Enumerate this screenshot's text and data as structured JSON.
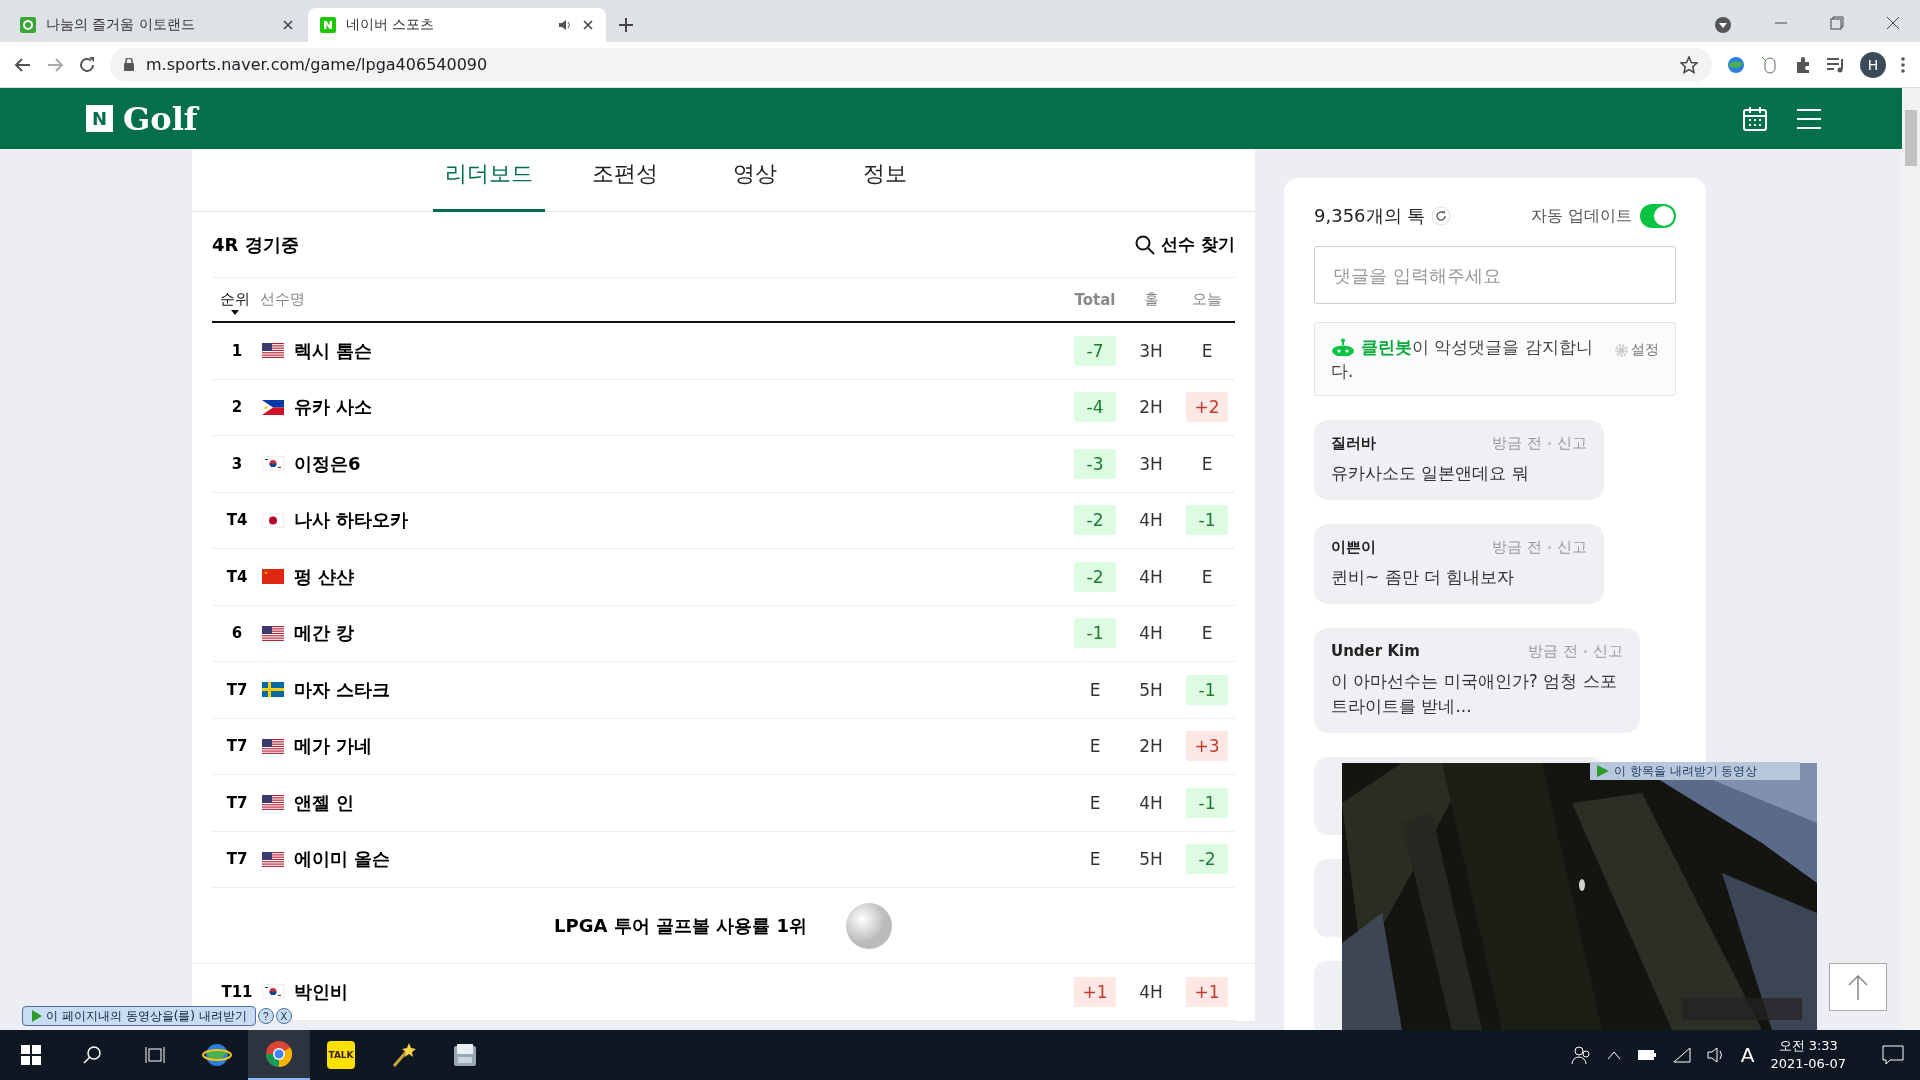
{
  "browser": {
    "tabs": [
      {
        "title": "나눔의 즐거움 이토랜드",
        "kind": "eto",
        "selected": false,
        "audio": false
      },
      {
        "title": "네이버 스포츠",
        "kind": "naver",
        "selected": true,
        "audio": true
      }
    ],
    "url": "m.sports.naver.com/game/lpga406540090",
    "profile": "H"
  },
  "header": {
    "logo": "N",
    "title": "Golf"
  },
  "tabs": [
    {
      "label": "리더보드",
      "selected": true
    },
    {
      "label": "조편성",
      "selected": false
    },
    {
      "label": "영상",
      "selected": false
    },
    {
      "label": "정보",
      "selected": false
    }
  ],
  "leaderboard": {
    "status": "4R 경기중",
    "find": "선수 찾기",
    "columns": [
      {
        "label": "순위",
        "sorted": true
      },
      {
        "label": "선수명",
        "sorted": false
      },
      {
        "label": "Total",
        "sorted": false
      },
      {
        "label": "홀",
        "sorted": false
      },
      {
        "label": "오늘",
        "sorted": false
      }
    ],
    "rows": [
      {
        "rank": "1",
        "flag": {
          "kind": "us"
        },
        "name": "렉시 톰슨",
        "total": {
          "text": "-7",
          "kind": "under"
        },
        "hole": "3H",
        "today": {
          "text": "E",
          "kind": "even"
        }
      },
      {
        "rank": "2",
        "flag": {
          "kind": "ph"
        },
        "name": "유카 사소",
        "total": {
          "text": "-4",
          "kind": "under"
        },
        "hole": "2H",
        "today": {
          "text": "+2",
          "kind": "over"
        }
      },
      {
        "rank": "3",
        "flag": {
          "kind": "kr"
        },
        "name": "이정은6",
        "total": {
          "text": "-3",
          "kind": "under"
        },
        "hole": "3H",
        "today": {
          "text": "E",
          "kind": "even"
        }
      },
      {
        "rank": "T4",
        "flag": {
          "kind": "jp"
        },
        "name": "나사 하타오카",
        "total": {
          "text": "-2",
          "kind": "under"
        },
        "hole": "4H",
        "today": {
          "text": "-1",
          "kind": "under"
        }
      },
      {
        "rank": "T4",
        "flag": {
          "kind": "cn"
        },
        "name": "펑 샨샨",
        "total": {
          "text": "-2",
          "kind": "under"
        },
        "hole": "4H",
        "today": {
          "text": "E",
          "kind": "even"
        }
      },
      {
        "rank": "6",
        "flag": {
          "kind": "us"
        },
        "name": "메간 캉",
        "total": {
          "text": "-1",
          "kind": "under"
        },
        "hole": "4H",
        "today": {
          "text": "E",
          "kind": "even"
        }
      },
      {
        "rank": "T7",
        "flag": {
          "kind": "se"
        },
        "name": "마자 스타크",
        "total": {
          "text": "E",
          "kind": "even"
        },
        "hole": "5H",
        "today": {
          "text": "-1",
          "kind": "under"
        }
      },
      {
        "rank": "T7",
        "flag": {
          "kind": "us"
        },
        "name": "메가 가네",
        "total": {
          "text": "E",
          "kind": "even"
        },
        "hole": "2H",
        "today": {
          "text": "+3",
          "kind": "over"
        }
      },
      {
        "rank": "T7",
        "flag": {
          "kind": "us"
        },
        "name": "앤젤 인",
        "total": {
          "text": "E",
          "kind": "even"
        },
        "hole": "4H",
        "today": {
          "text": "-1",
          "kind": "under"
        }
      },
      {
        "rank": "T7",
        "flag": {
          "kind": "us"
        },
        "name": "에이미 올슨",
        "total": {
          "text": "E",
          "kind": "even"
        },
        "hole": "5H",
        "today": {
          "text": "-2",
          "kind": "under"
        }
      }
    ],
    "ad": "LPGA 투어 골프볼 사용률 1위",
    "after_rows": [
      {
        "rank": "T11",
        "flag": {
          "kind": "kr"
        },
        "name": "박인비",
        "total": {
          "text": "+1",
          "kind": "over"
        },
        "hole": "4H",
        "today": {
          "text": "+1",
          "kind": "over"
        }
      }
    ]
  },
  "talk": {
    "count": "9,356개의 톡",
    "auto_update": {
      "label": "자동 업데이트",
      "on": true
    },
    "placeholder": "댓글을 입력해주세요",
    "cleanbot": {
      "text": "**클린봇**이 악성댓글을 감지합니다.",
      "settings": "설정"
    },
    "comments": [
      {
        "kind": "shown",
        "author": "질러바",
        "time": "방금 전",
        "report": "신고",
        "text": "유카사소도 일본앤데요 뭐"
      },
      {
        "kind": "shown",
        "author": "이쁜이",
        "time": "방금 전",
        "report": "신고",
        "text": "퀸비~ 좀만 더 힘내보자"
      },
      {
        "kind": "shown",
        "author": "Under Kim",
        "time": "방금 전",
        "report": "신고",
        "text": "이 아마선수는 미국애인가? 엄청 스포트라이트를 받네..."
      },
      {
        "kind": "covered"
      },
      {
        "kind": "covered"
      },
      {
        "kind": "covered"
      }
    ]
  },
  "video": {
    "kind": "picture",
    "download_bar": "이 항목을 내려받기 동영상"
  },
  "download_button": {
    "label": "이 페이지내의 동영상을(를) 내려받기",
    "help": "?",
    "close": "X"
  },
  "taskbar": {
    "apps": [
      {
        "kind": "ie",
        "active": false
      },
      {
        "kind": "chrome",
        "active": true
      },
      {
        "kind": "talk",
        "label": "TALK",
        "active": false
      },
      {
        "kind": "wand",
        "active": false
      },
      {
        "kind": "tool",
        "active": false
      }
    ],
    "ime": "A",
    "time": "오전 3:33",
    "date": "2021-06-07"
  }
}
